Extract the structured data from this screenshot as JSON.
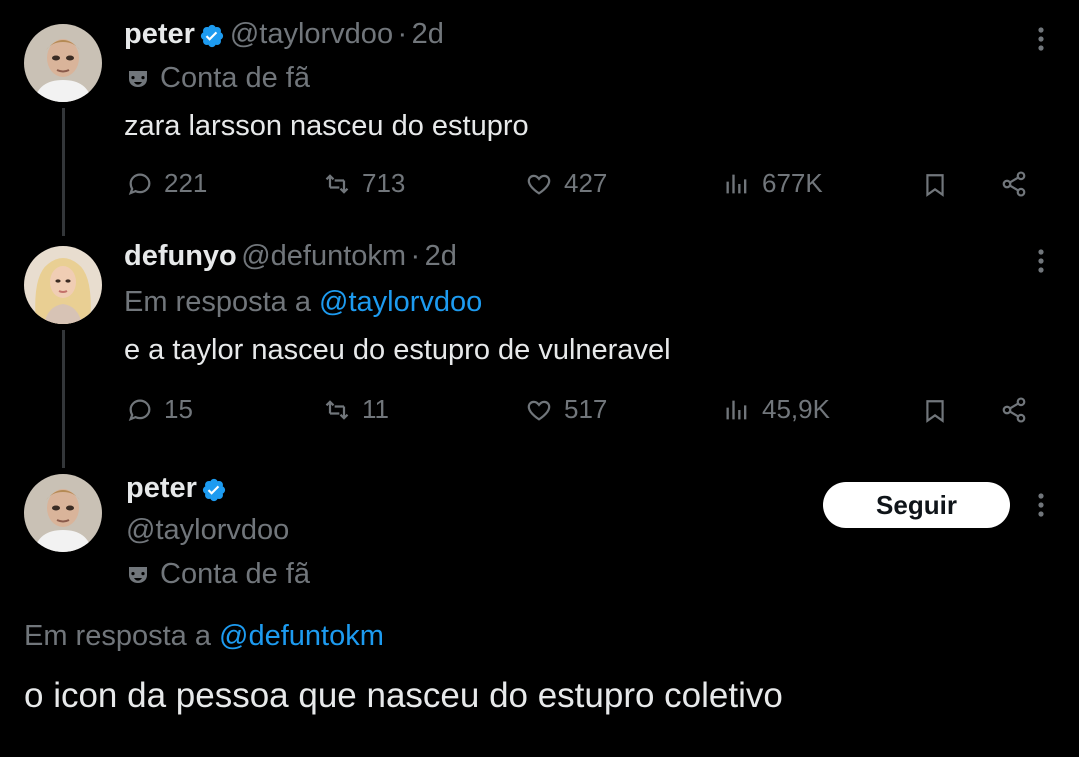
{
  "tweets": [
    {
      "name": "peter",
      "handle": "@taylorvdoo",
      "dot": "·",
      "time": "2d",
      "fan_label": "Conta de fã",
      "text": "zara larsson nasceu do estupro",
      "replies": "221",
      "retweets": "713",
      "likes": "427",
      "views": "677K"
    },
    {
      "name": "defunyo",
      "handle": "@defuntokm",
      "dot": "·",
      "time": "2d",
      "reply_prefix": "Em resposta a",
      "reply_mention": "@taylorvdoo",
      "text": "e a taylor nasceu do estupro de vulneravel",
      "replies": "15",
      "retweets": "11",
      "likes": "517",
      "views": "45,9K"
    }
  ],
  "main_tweet": {
    "name": "peter",
    "handle": "@taylorvdoo",
    "fan_label": "Conta de fã",
    "follow_label": "Seguir",
    "reply_prefix": "Em resposta a",
    "reply_mention": "@defuntokm",
    "text": "o icon da pessoa que nasceu do estupro coletivo"
  },
  "colors": {
    "background": "#000000",
    "text": "#e7e9ea",
    "secondary": "#71767b",
    "link": "#1d9bf0",
    "verified": "#1d9bf0"
  }
}
